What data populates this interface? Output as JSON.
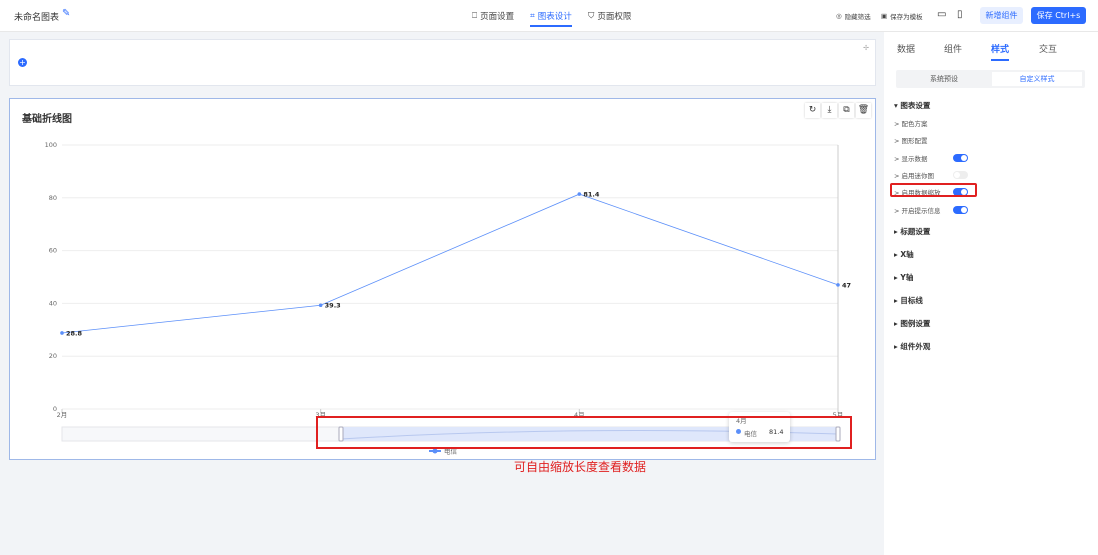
{
  "header": {
    "title": "未命名图表",
    "tabs": [
      {
        "label": "页面设置"
      },
      {
        "label": "图表设计"
      },
      {
        "label": "页面权限"
      }
    ],
    "hide_filter": "隐藏筛选",
    "save_template": "保存为模板",
    "add_component": "新增组件",
    "save": "保存 Ctrl+s"
  },
  "panel": {
    "tabs": [
      "数据",
      "组件",
      "样式",
      "交互"
    ],
    "active_tab": "样式",
    "subtabs": [
      "系统预设",
      "自定义样式"
    ],
    "chart_settings": "图表设置",
    "items": [
      {
        "label": "配色方案"
      },
      {
        "label": "图形配置"
      },
      {
        "label": "显示数据",
        "toggle": true
      },
      {
        "label": "启用迷你图",
        "toggle": false
      },
      {
        "label": "启用数据缩放",
        "toggle": true
      },
      {
        "label": "开启提示信息",
        "toggle": true
      }
    ],
    "sections": [
      "标题设置",
      "X轴",
      "Y轴",
      "目标线",
      "图例设置",
      "组件外观"
    ]
  },
  "chart_data": {
    "type": "line",
    "title": "基础折线图",
    "categories": [
      "2月",
      "3月",
      "4月",
      "5月"
    ],
    "series": [
      {
        "name": "电信",
        "values": [
          28.8,
          39.3,
          81.4,
          47
        ],
        "color": "#5b8ff9"
      }
    ],
    "ylim": [
      0,
      100
    ],
    "yticks": [
      0,
      20,
      40,
      60,
      80,
      100
    ],
    "grid": true,
    "legend": "bottom",
    "datazoom": true
  },
  "tooltip": {
    "category": "4月",
    "series": "电信",
    "value": "81.4"
  },
  "annotation": "可自由缩放长度查看数据",
  "colors": {
    "accent": "#2c6bff",
    "highlight": "#e02020"
  }
}
